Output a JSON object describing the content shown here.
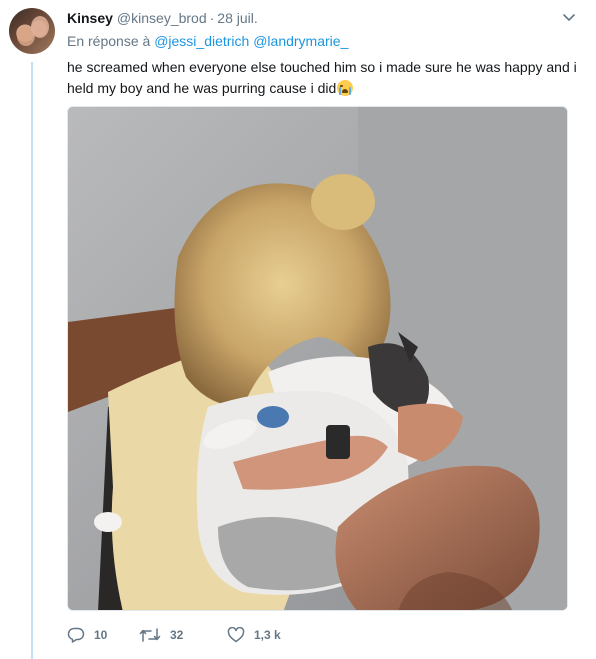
{
  "tweet": {
    "author_name": "Kinsey",
    "author_handle": "@kinsey_brod",
    "separator": "·",
    "date": "28 juil.",
    "reply_prefix": "En réponse à",
    "mentions": [
      "@jessi_dietrich",
      "@landrymarie_"
    ],
    "text": "he screamed when everyone else touched him so i made sure he was happy and i held my boy and he was purring cause i did",
    "emoji": "loudly-crying-face"
  },
  "actions": {
    "replies": "10",
    "retweets": "32",
    "likes": "1,3 k"
  },
  "icons": {
    "menu": "chevron-down-icon",
    "reply": "reply-icon",
    "retweet": "retweet-icon",
    "like": "heart-icon"
  },
  "colors": {
    "link": "#1b95e0",
    "muted": "#657786",
    "thread_line": "#c4e0f2"
  }
}
